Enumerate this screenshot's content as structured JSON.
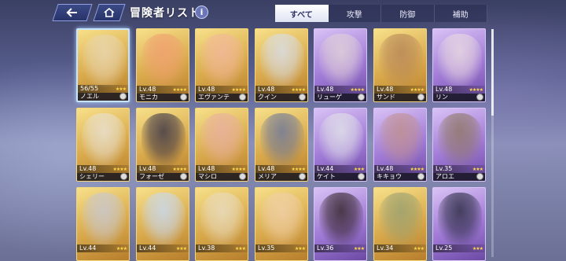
{
  "header": {
    "title": "冒険者リスト",
    "back_icon": "back-arrow-icon",
    "home_icon": "home-icon",
    "info_label": "i"
  },
  "tabs": [
    {
      "label": "すべて",
      "active": true
    },
    {
      "label": "攻撃",
      "active": false
    },
    {
      "label": "防御",
      "active": false
    },
    {
      "label": "補助",
      "active": false
    }
  ],
  "colors": {
    "gold_frame": "#d8a84a",
    "purple_frame": "#a07ad6",
    "tab_active": "#ffffff"
  },
  "cards": [
    {
      "level": "56/55",
      "name": "ノエル",
      "stars": "★★★",
      "frame": "gold",
      "selected": true,
      "tint": "#e8d6b0"
    },
    {
      "level": "Lv.48",
      "name": "モニカ",
      "stars": "★★★★",
      "frame": "gold",
      "tint": "#f0a070"
    },
    {
      "level": "Lv.48",
      "name": "エヴァンテ",
      "stars": "★★★★",
      "frame": "gold",
      "tint": "#f2b89a"
    },
    {
      "level": "Lv.48",
      "name": "クイン",
      "stars": "★★★★",
      "frame": "gold",
      "tint": "#d8dde8"
    },
    {
      "level": "Lv.48",
      "name": "リューゲ",
      "stars": "★★★★",
      "frame": "purple",
      "tint": "#e0d0d8"
    },
    {
      "level": "Lv.48",
      "name": "サンド",
      "stars": "★★★★",
      "frame": "gold",
      "tint": "#b8885a"
    },
    {
      "level": "Lv.48",
      "name": "リン",
      "stars": "★★★★",
      "frame": "purple",
      "tint": "#e8d8e0"
    },
    {
      "level": "Lv.48",
      "name": "シェリー",
      "stars": "★★★★",
      "frame": "gold",
      "tint": "#e8e0d0"
    },
    {
      "level": "Lv.48",
      "name": "フォーゼ",
      "stars": "★★★★",
      "frame": "gold",
      "tint": "#403848"
    },
    {
      "level": "Lv.48",
      "name": "マシロ",
      "stars": "★★★★",
      "frame": "gold",
      "tint": "#e8b0a0"
    },
    {
      "level": "Lv.48",
      "name": "メリア",
      "stars": "★★★★",
      "frame": "gold",
      "tint": "#707898"
    },
    {
      "level": "Lv.44",
      "name": "ケイト",
      "stars": "★★★",
      "frame": "purple",
      "tint": "#e0e0e8"
    },
    {
      "level": "Lv.48",
      "name": "キキョウ",
      "stars": "★★★★",
      "frame": "purple",
      "tint": "#c09090"
    },
    {
      "level": "Lv.35",
      "name": "アロエ",
      "stars": "★★★",
      "frame": "purple",
      "tint": "#907868"
    },
    {
      "level": "Lv.44",
      "name": "",
      "stars": "★★★",
      "frame": "gold",
      "tint": "#c8c8d0"
    },
    {
      "level": "Lv.44",
      "name": "",
      "stars": "★★★",
      "frame": "gold",
      "tint": "#c8d8f0"
    },
    {
      "level": "Lv.38",
      "name": "",
      "stars": "★★★",
      "frame": "gold",
      "tint": "#e8dcc0"
    },
    {
      "level": "Lv.35",
      "name": "",
      "stars": "★★★",
      "frame": "gold",
      "tint": "#f0d0a8"
    },
    {
      "level": "Lv.36",
      "name": "",
      "stars": "★★★",
      "frame": "purple",
      "tint": "#382830"
    },
    {
      "level": "Lv.34",
      "name": "",
      "stars": "★★★",
      "frame": "gold",
      "tint": "#9aa070"
    },
    {
      "level": "Lv.25",
      "name": "",
      "stars": "★★★",
      "frame": "purple",
      "tint": "#303048"
    }
  ]
}
